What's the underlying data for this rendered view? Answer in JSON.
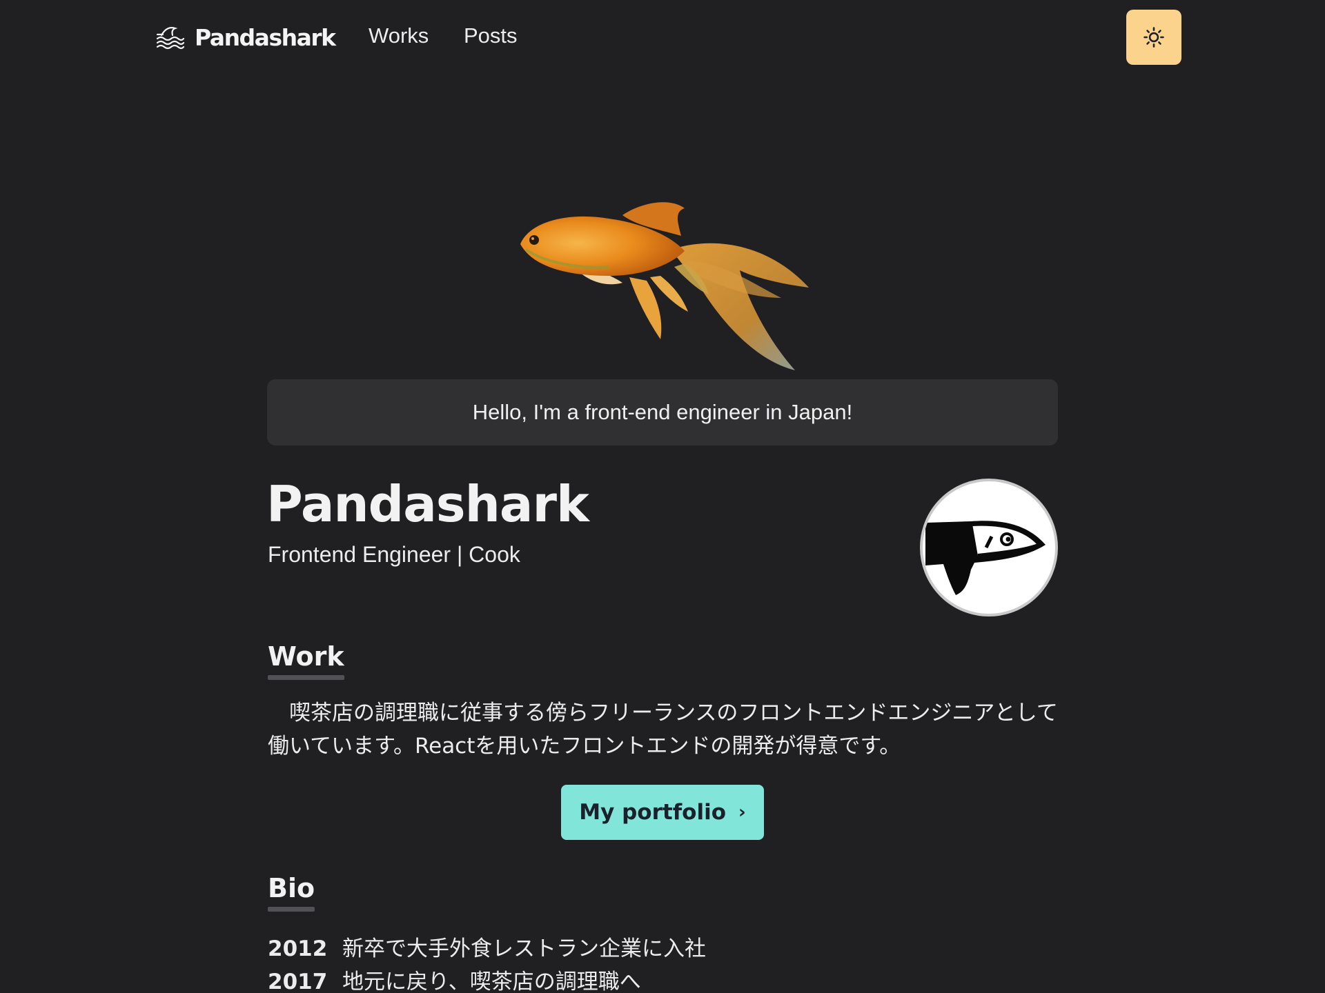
{
  "nav": {
    "brand": "Pandashark",
    "links": [
      {
        "label": "Works"
      },
      {
        "label": "Posts"
      }
    ],
    "theme_icon": "sun-icon",
    "theme_color": "#fbd38d"
  },
  "hero": {
    "image": "goldfish-image",
    "greeting": "Hello, I'm a front-end engineer in Japan!"
  },
  "profile": {
    "name": "Pandashark",
    "role": "Frontend Engineer | Cook",
    "avatar": "shark-avatar"
  },
  "work": {
    "heading": "Work",
    "text": "喫茶店の調理職に従事する傍らフリーランスのフロントエンドエンジニアとして働いています。Reactを用いたフロントエンドの開発が得意です。",
    "button_label": "My portfolio",
    "button_color": "#81e6d9"
  },
  "bio": {
    "heading": "Bio",
    "entries": [
      {
        "year": "2012",
        "text": "新卒で大手外食レストラン企業に入社"
      },
      {
        "year": "2017",
        "text": "地元に戻り、喫茶店の調理職へ"
      }
    ]
  },
  "colors": {
    "background": "#202023",
    "card": "#303032",
    "accent": "#81e6d9"
  }
}
